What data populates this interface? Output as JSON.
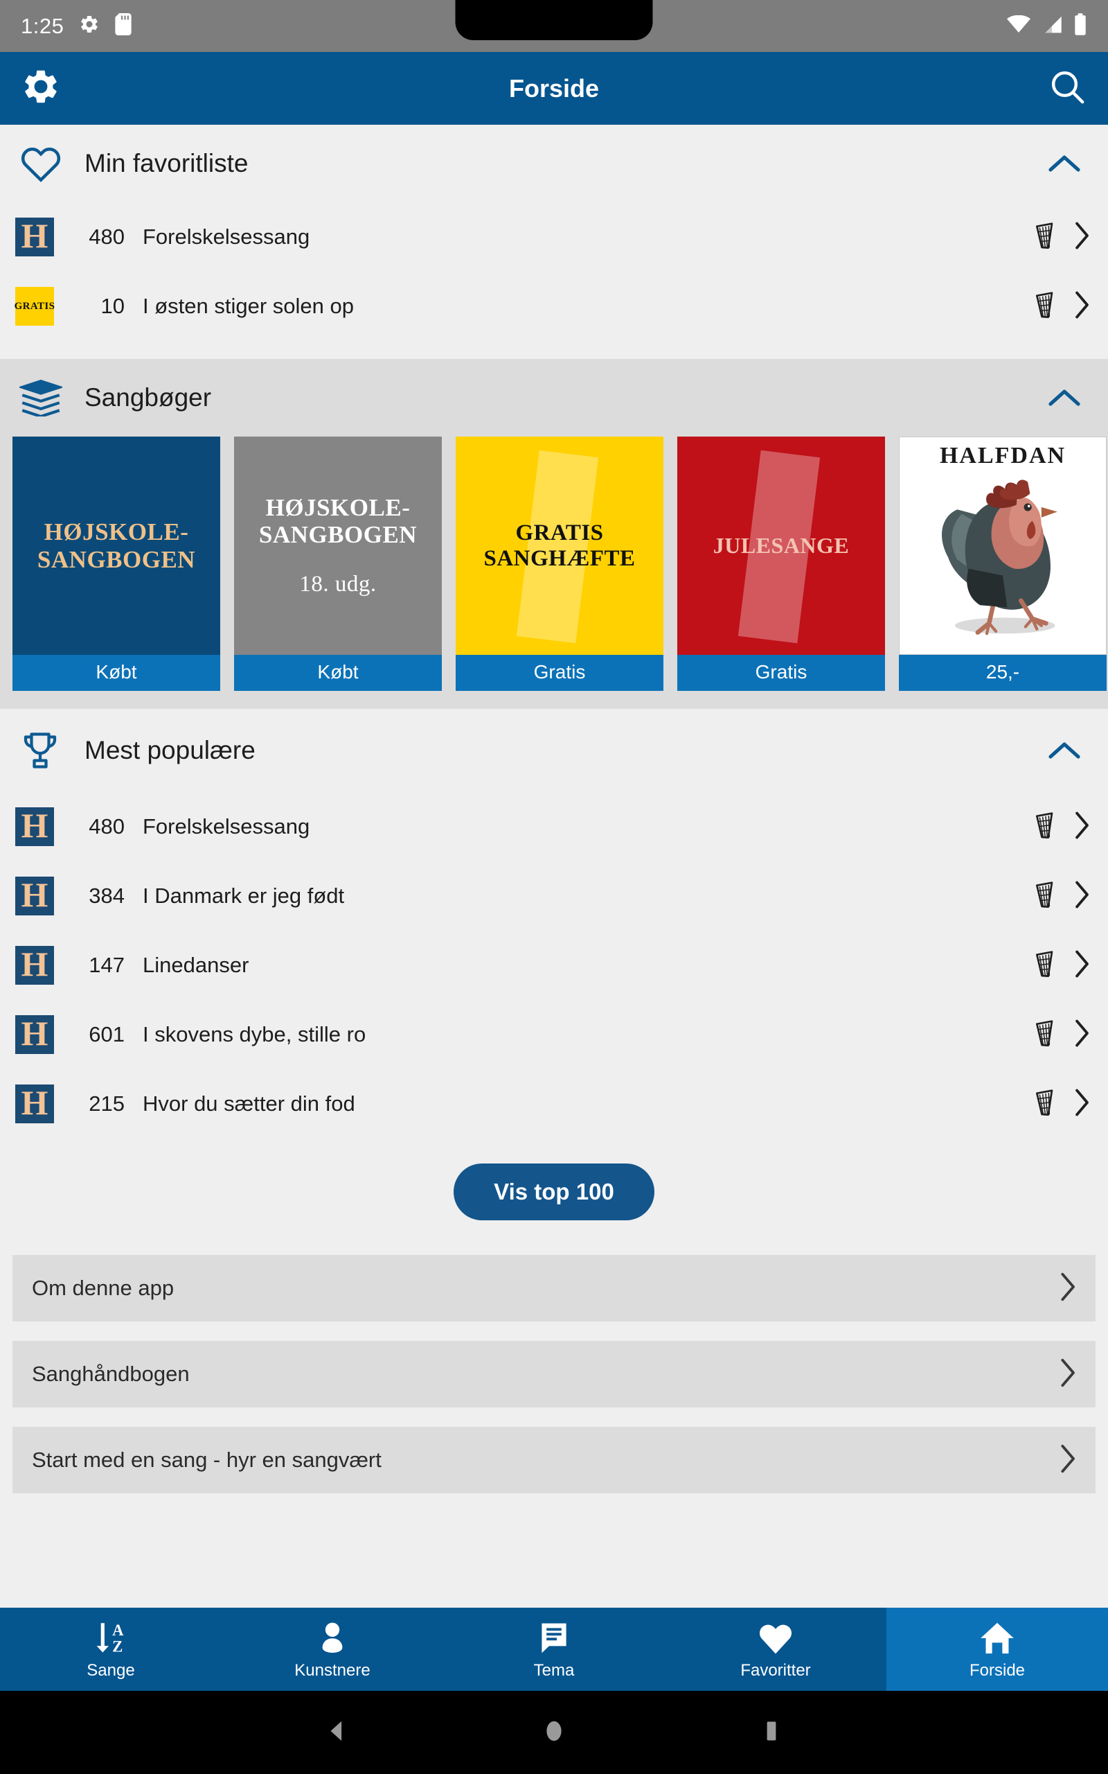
{
  "statusbar": {
    "time": "1:25",
    "icons_left": [
      "gear-icon",
      "sd-card-icon"
    ],
    "icons_right": [
      "wifi-icon",
      "cellular-signal-icon",
      "battery-icon"
    ]
  },
  "appbar": {
    "title": "Forside",
    "left_icon": "gear-icon",
    "right_icon": "search-icon"
  },
  "sections": {
    "favorites": {
      "icon": "heart-icon",
      "title": "Min favoritliste",
      "collapse_icon": "chevron-up-icon",
      "rows": [
        {
          "badge": "H",
          "badge_type": "h",
          "number": "480",
          "title": "Forelskelsessang",
          "action_icon": "harp-icon",
          "chevron": "chevron-right-icon"
        },
        {
          "badge": "GRATIS",
          "badge_type": "gratis",
          "number": "10",
          "title": "I østen stiger solen op",
          "action_icon": "harp-icon",
          "chevron": "chevron-right-icon"
        }
      ]
    },
    "songbooks": {
      "icon": "books-stack-icon",
      "title": "Sangbøger",
      "collapse_icon": "chevron-up-icon",
      "books": [
        {
          "cover_title": "HØJSKOLE-\nSANGBOGEN",
          "subtitle": "",
          "label": "Købt",
          "style": "cover-blue",
          "art": "text"
        },
        {
          "cover_title": "HØJSKOLE-\nSANGBOGEN",
          "subtitle": "18. udg.",
          "label": "Købt",
          "style": "cover-grey",
          "art": "text"
        },
        {
          "cover_title": "GRATIS\nSANGHÆFTE",
          "subtitle": "",
          "label": "Gratis",
          "style": "cover-yellow",
          "art": "text"
        },
        {
          "cover_title": "JULESANGE",
          "subtitle": "",
          "label": "Gratis",
          "style": "cover-red",
          "art": "text"
        },
        {
          "cover_title": "HALFDAN",
          "subtitle": "",
          "label": "25,-",
          "style": "cover-white",
          "art": "rooster"
        }
      ]
    },
    "popular": {
      "icon": "trophy-icon",
      "title": "Mest populære",
      "collapse_icon": "chevron-up-icon",
      "rows": [
        {
          "badge": "H",
          "badge_type": "h",
          "number": "480",
          "title": "Forelskelsessang",
          "action_icon": "harp-icon",
          "chevron": "chevron-right-icon"
        },
        {
          "badge": "H",
          "badge_type": "h",
          "number": "384",
          "title": "I Danmark er jeg født",
          "action_icon": "harp-icon",
          "chevron": "chevron-right-icon"
        },
        {
          "badge": "H",
          "badge_type": "h",
          "number": "147",
          "title": "Linedanser",
          "action_icon": "harp-icon",
          "chevron": "chevron-right-icon"
        },
        {
          "badge": "H",
          "badge_type": "h",
          "number": "601",
          "title": "I skovens dybe, stille ro",
          "action_icon": "harp-icon",
          "chevron": "chevron-right-icon"
        },
        {
          "badge": "H",
          "badge_type": "h",
          "number": "215",
          "title": "Hvor du sætter din fod",
          "action_icon": "harp-icon",
          "chevron": "chevron-right-icon"
        }
      ],
      "top100_button": "Vis top 100"
    }
  },
  "link_rows": [
    {
      "label": "Om denne app",
      "chevron": "chevron-right-icon"
    },
    {
      "label": "Sanghåndbogen",
      "chevron": "chevron-right-icon"
    },
    {
      "label": "Start med en sang - hyr en sangvært",
      "chevron": "chevron-right-icon"
    }
  ],
  "bottom_nav": [
    {
      "label": "Sange",
      "icon": "sort-az-icon",
      "active": false
    },
    {
      "label": "Kunstnere",
      "icon": "person-icon",
      "active": false
    },
    {
      "label": "Tema",
      "icon": "speech-list-icon",
      "active": false
    },
    {
      "label": "Favoritter",
      "icon": "heart-filled-icon",
      "active": false
    },
    {
      "label": "Forside",
      "icon": "home-icon",
      "active": true
    }
  ],
  "android_nav": [
    {
      "icon": "back-triangle-icon"
    },
    {
      "icon": "home-circle-icon"
    },
    {
      "icon": "recents-square-icon"
    }
  ],
  "colors": {
    "brand_blue": "#05558f",
    "accent_blue": "#0c72b8",
    "badge_navy": "#1b4a73",
    "badge_peach": "#f3c395",
    "gratis_yellow": "#ffd100",
    "section_grey": "#dcdcdc",
    "page_grey": "#efefef",
    "statusbar_grey": "#7d7d7d"
  }
}
